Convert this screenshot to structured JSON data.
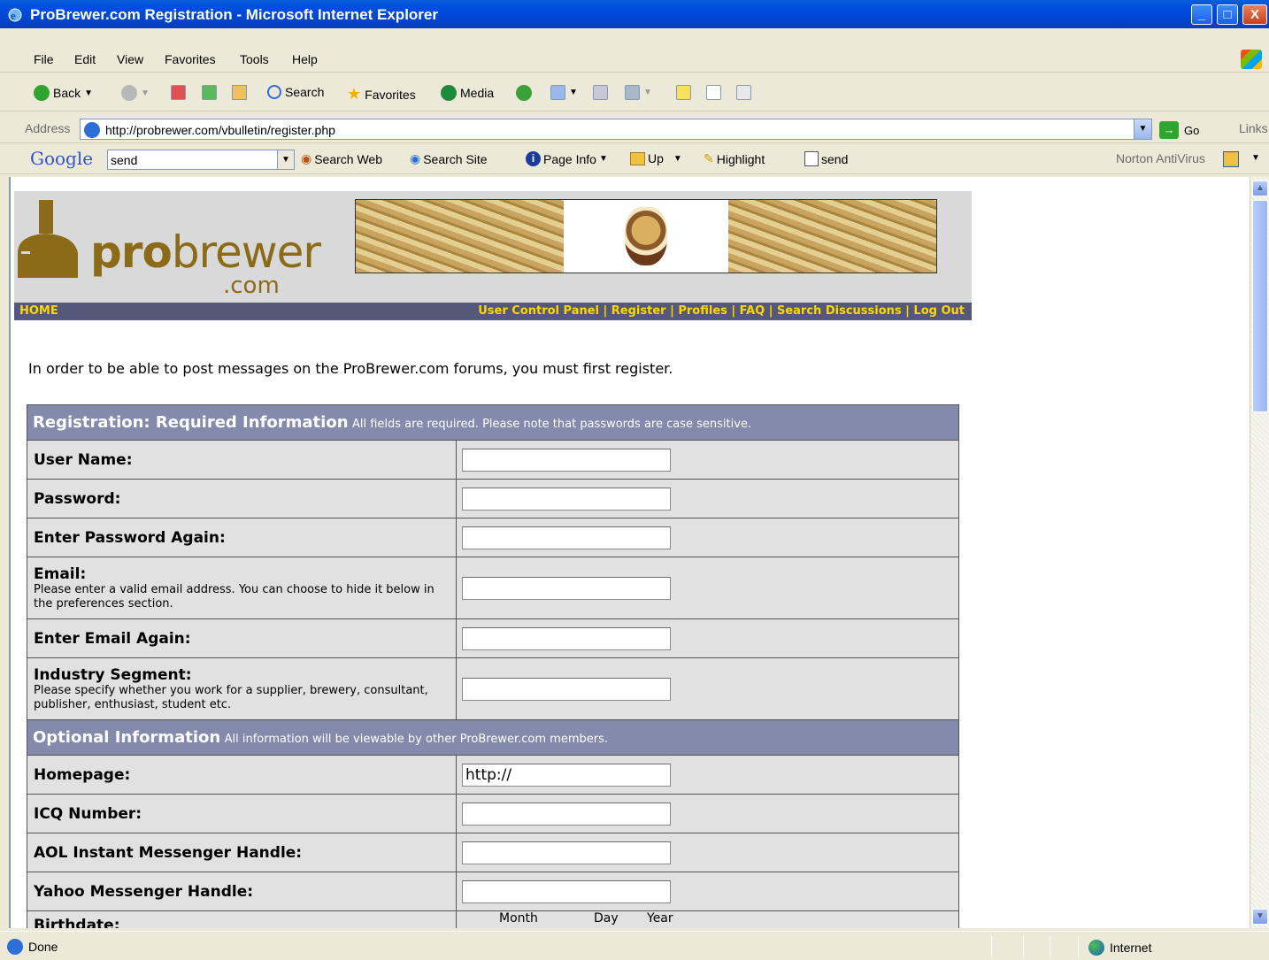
{
  "window": {
    "title": "ProBrewer.com Registration - Microsoft Internet Explorer",
    "controls": {
      "minimize": "_",
      "maximize": "□",
      "close": "X"
    }
  },
  "menu": [
    "File",
    "Edit",
    "View",
    "Favorites",
    "Tools",
    "Help"
  ],
  "toolbar": {
    "back": "Back",
    "search": "Search",
    "favorites": "Favorites",
    "media": "Media"
  },
  "address": {
    "label": "Address",
    "url": "http://probrewer.com/vbulletin/register.php",
    "go": "Go",
    "links": "Links"
  },
  "googlebar": {
    "logo": "Google",
    "query": "send",
    "search_web": "Search Web",
    "search_site": "Search Site",
    "page_info": "Page Info",
    "up": "Up",
    "highlight": "Highlight",
    "send": "send",
    "norton": "Norton AntiVirus"
  },
  "site": {
    "logo_main_bold": "pro",
    "logo_main_rest": "brewer",
    "logo_sub": ".com",
    "nav_home": "HOME",
    "nav_links": "User Control Panel | Register | Profiles | FAQ | Search Discussions | Log Out"
  },
  "page": {
    "intro": "In order to be able to post messages on the ProBrewer.com forums, you must first register."
  },
  "form": {
    "required": {
      "title": "Registration: Required Information",
      "note": "All fields are required. Please note that passwords are case sensitive.",
      "fields": [
        {
          "label": "User Name:",
          "desc": "",
          "value": ""
        },
        {
          "label": "Password:",
          "desc": "",
          "value": ""
        },
        {
          "label": "Enter Password Again:",
          "desc": "",
          "value": ""
        },
        {
          "label": "Email:",
          "desc": "Please enter a valid email address. You can choose to hide it below in the preferences section.",
          "value": ""
        },
        {
          "label": "Enter Email Again:",
          "desc": "",
          "value": ""
        },
        {
          "label": "Industry Segment:",
          "desc": "Please specify whether you work for a supplier, brewery, consultant, publisher, enthusiast, student etc.",
          "value": ""
        }
      ]
    },
    "optional": {
      "title": "Optional Information",
      "note": "All information will be viewable by other ProBrewer.com members.",
      "fields": [
        {
          "label": "Homepage:",
          "value": "http://"
        },
        {
          "label": "ICQ Number:",
          "value": ""
        },
        {
          "label": "AOL Instant Messenger Handle:",
          "value": ""
        },
        {
          "label": "Yahoo Messenger Handle:",
          "value": ""
        }
      ],
      "birthdate": {
        "label": "Birthdate:",
        "month": "Month",
        "day": "Day",
        "year": "Year"
      }
    }
  },
  "status": {
    "text": "Done",
    "zone": "Internet"
  }
}
